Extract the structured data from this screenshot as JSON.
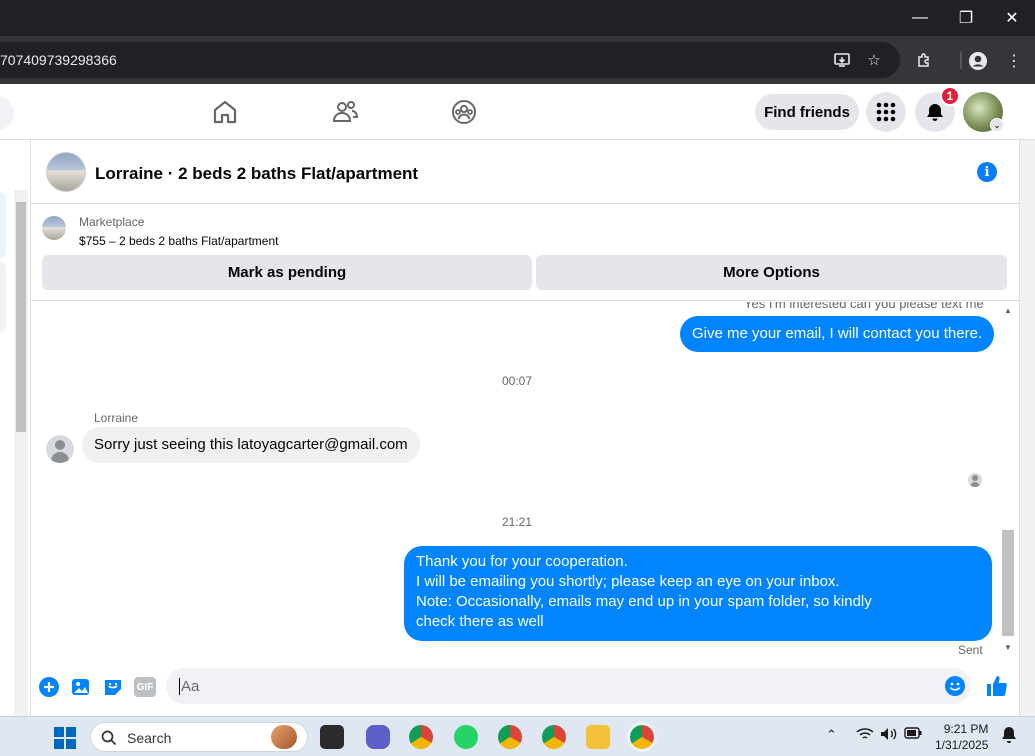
{
  "browser": {
    "url": "707409739298366",
    "window_controls": {
      "minimize": "—",
      "restore": "❐",
      "close": "✕"
    }
  },
  "fb_nav": {
    "find_friends_label": "Find friends",
    "notification_count": "1"
  },
  "thread": {
    "title": "Lorraine · 2 beds 2 baths Flat/apartment"
  },
  "marketplace": {
    "label": "Marketplace",
    "listing": "$755 – 2 beds 2 baths Flat/apartment",
    "mark_pending_label": "Mark as pending",
    "more_options_label": "More Options"
  },
  "messages": {
    "faded_text": "Yes I'm interested can you please text me",
    "out_1": "Give me your email, I will contact you there.",
    "time_1": "00:07",
    "sender_name": "Lorraine",
    "in_1": "Sorry just seeing this latoyagcarter@gmail.com",
    "time_2": "21:21",
    "out_2_lines": [
      "Thank you for your cooperation.",
      "I will be emailing you shortly; please keep an eye on your inbox.",
      "Note: Occasionally, emails may end up in your spam folder, so kindly",
      "check there as well"
    ],
    "status": "Sent"
  },
  "composer": {
    "placeholder": "Aa",
    "gif_label": "GIF"
  },
  "taskbar": {
    "search_label": "Search",
    "time": "9:21 PM",
    "date": "1/31/2025"
  },
  "colors": {
    "accent_blue": "#0084ff",
    "info_blue": "#0a7cff",
    "badge_red": "#e41e3f"
  }
}
